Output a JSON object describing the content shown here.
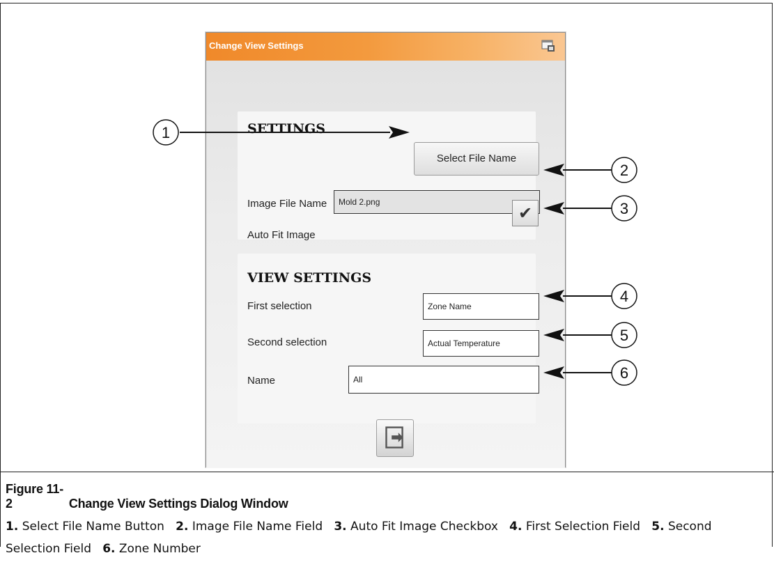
{
  "dialog": {
    "title": "Change View Settings",
    "settings_heading": "SETTINGS",
    "select_file_button": "Select File Name",
    "image_file_name_label": "Image File Name",
    "image_file_name_value": "Mold 2.png",
    "auto_fit_label": "Auto Fit Image",
    "auto_fit_checked": true,
    "view_settings_heading": "VIEW SETTINGS",
    "first_selection_label": "First selection",
    "first_selection_value": "Zone Name",
    "second_selection_label": "Second selection",
    "second_selection_value": "Actual Temperature",
    "name_label": "Name",
    "name_value": "All",
    "title_gradient": [
      "#f0892a",
      "#fac792"
    ]
  },
  "callouts": [
    "1",
    "2",
    "3",
    "4",
    "5",
    "6"
  ],
  "figure": {
    "number": "Figure 11-2",
    "title": "Change View Settings Dialog Window"
  },
  "legend": [
    {
      "num": "1.",
      "text": "Select File Name Button"
    },
    {
      "num": "2.",
      "text": "Image File Name Field"
    },
    {
      "num": "3.",
      "text": "Auto Fit Image Checkbox"
    },
    {
      "num": "4.",
      "text": "First Selection Field"
    },
    {
      "num": "5.",
      "text": "Second Selection Field"
    },
    {
      "num": "6.",
      "text": "Zone Number"
    }
  ]
}
